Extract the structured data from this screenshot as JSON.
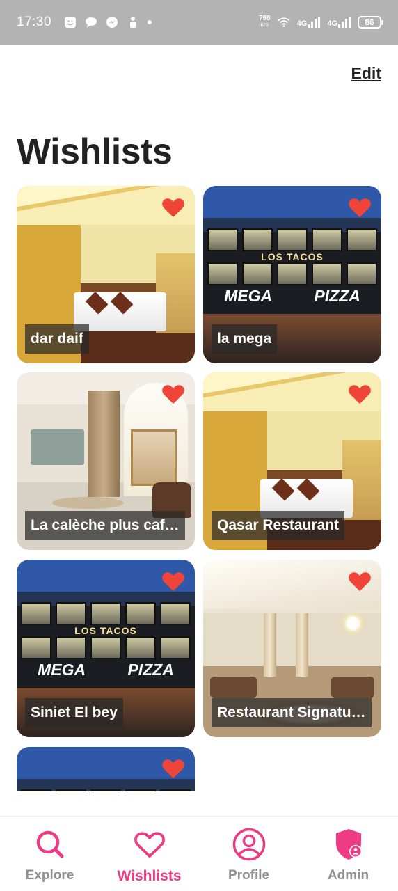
{
  "status_bar": {
    "time": "17:30",
    "net_speed": "798",
    "net_unit": "K/S",
    "signal1": "4G",
    "signal2": "4G",
    "battery": "86"
  },
  "header": {
    "edit_label": "Edit",
    "title": "Wishlists"
  },
  "wishlist": [
    {
      "label": "dar daif",
      "photo": "hotel-room",
      "favorited": true
    },
    {
      "label": "la mega",
      "photo": "storefront-night",
      "favorited": true
    },
    {
      "label": "La calèche plus caf…",
      "photo": "lounge-room",
      "favorited": true
    },
    {
      "label": "Qasar Restaurant",
      "photo": "hotel-room",
      "favorited": true
    },
    {
      "label": "Siniet El bey",
      "photo": "storefront-night",
      "favorited": true
    },
    {
      "label": "Restaurant Signatu…",
      "photo": "lobby",
      "favorited": true
    },
    {
      "label": "",
      "photo": "storefront-night",
      "favorited": true
    }
  ],
  "storefront_signs": {
    "top": "LOS TACOS",
    "left": "MEGA",
    "right": "PIZZA"
  },
  "bottom_nav": [
    {
      "label": "Explore",
      "icon": "search-icon",
      "active": false
    },
    {
      "label": "Wishlists",
      "icon": "heart-icon",
      "active": true
    },
    {
      "label": "Profile",
      "icon": "user-circle-icon",
      "active": false
    },
    {
      "label": "Admin",
      "icon": "admin-shield-icon",
      "active": false
    }
  ],
  "colors": {
    "accent": "#ed3b84",
    "heart": "#ef4438",
    "nav_inactive": "#8f8f8f",
    "status_bar": "#b3b3b3"
  }
}
